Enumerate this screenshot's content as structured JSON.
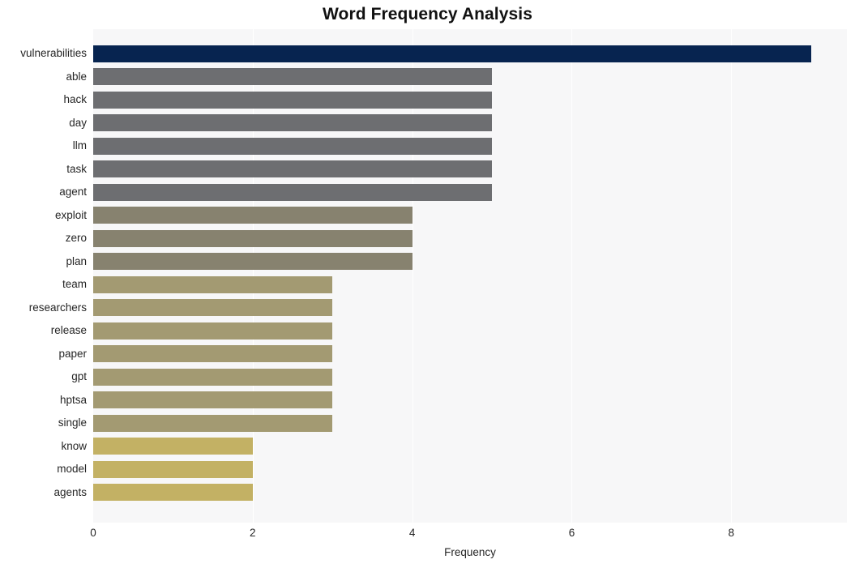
{
  "chart_data": {
    "type": "bar",
    "orientation": "horizontal",
    "title": "Word Frequency Analysis",
    "xlabel": "Frequency",
    "ylabel": "",
    "xlim": [
      0,
      9.45
    ],
    "xticks": [
      0,
      2,
      4,
      6,
      8
    ],
    "xticklabels": [
      "0",
      "2",
      "4",
      "6",
      "8"
    ],
    "grid": "vertical",
    "legend": "none",
    "plot_background": "#f7f7f8",
    "categories": [
      "vulnerabilities",
      "able",
      "hack",
      "day",
      "llm",
      "task",
      "agent",
      "exploit",
      "zero",
      "plan",
      "team",
      "researchers",
      "release",
      "paper",
      "gpt",
      "hptsa",
      "single",
      "know",
      "model",
      "agents"
    ],
    "values": [
      9,
      5,
      5,
      5,
      5,
      5,
      5,
      4,
      4,
      4,
      3,
      3,
      3,
      3,
      3,
      3,
      3,
      2,
      2,
      2
    ],
    "bar_colors": [
      "#072450",
      "#6d6e71",
      "#6d6e71",
      "#6d6e71",
      "#6d6e71",
      "#6d6e71",
      "#6d6e71",
      "#87826f",
      "#87826f",
      "#87826f",
      "#a39a72",
      "#a39a72",
      "#a39a72",
      "#a39a72",
      "#a39a72",
      "#a39a72",
      "#a39a72",
      "#c3b164",
      "#c3b164",
      "#c3b164"
    ]
  }
}
